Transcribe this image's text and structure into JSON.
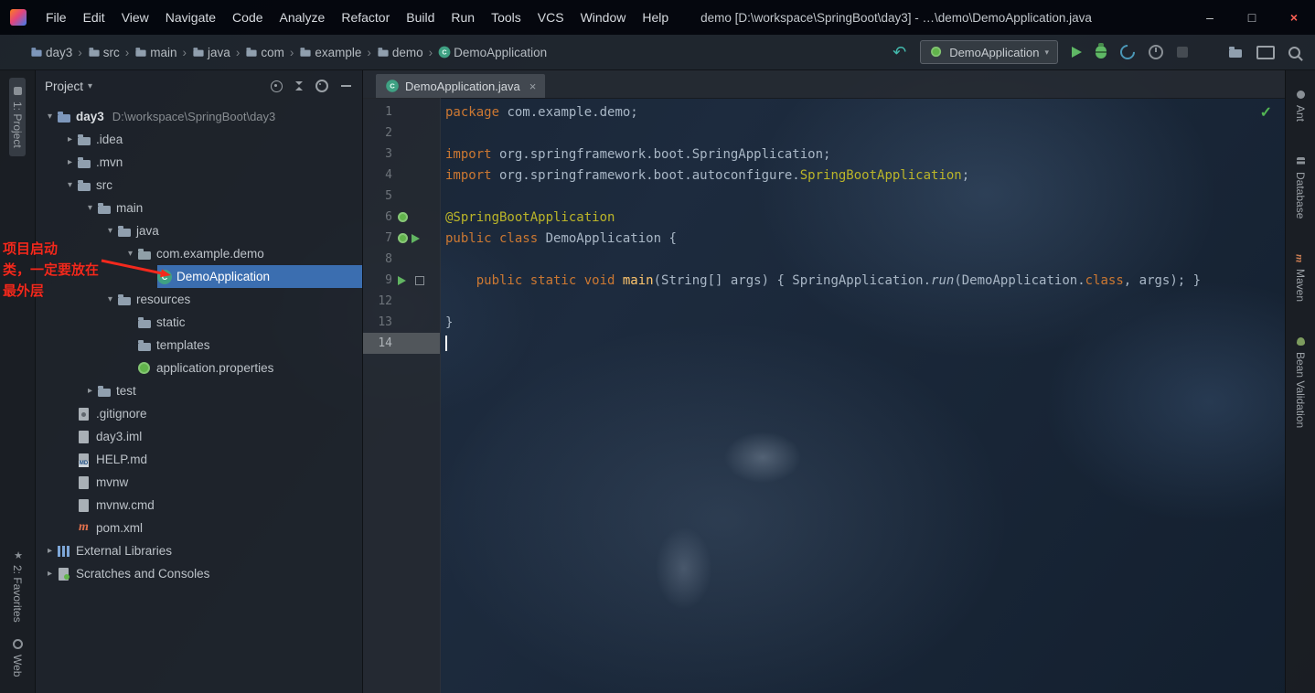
{
  "title_bar": {
    "title": "demo [D:\\workspace\\SpringBoot\\day3] - …\\demo\\DemoApplication.java",
    "menus": [
      "File",
      "Edit",
      "View",
      "Navigate",
      "Code",
      "Analyze",
      "Refactor",
      "Build",
      "Run",
      "Tools",
      "VCS",
      "Window",
      "Help"
    ]
  },
  "nav_bar": {
    "breadcrumbs": [
      {
        "label": "day3",
        "icon": "folder-blue"
      },
      {
        "label": "src",
        "icon": "folder"
      },
      {
        "label": "main",
        "icon": "folder"
      },
      {
        "label": "java",
        "icon": "folder"
      },
      {
        "label": "com",
        "icon": "folder"
      },
      {
        "label": "example",
        "icon": "folder"
      },
      {
        "label": "demo",
        "icon": "folder"
      },
      {
        "label": "DemoApplication",
        "icon": "class"
      }
    ],
    "run_config": "DemoApplication"
  },
  "left_stripe": {
    "top": [
      {
        "label": "1: Project",
        "icon": "project",
        "active": true
      }
    ],
    "bottom": [
      {
        "label": "2: Favorites",
        "icon": "star"
      },
      {
        "label": "Web",
        "icon": "web"
      }
    ]
  },
  "right_stripe": [
    {
      "label": "Ant",
      "icon": "ant"
    },
    {
      "label": "Database",
      "icon": "database"
    },
    {
      "label": "Maven",
      "icon": "maven"
    },
    {
      "label": "Bean Validation",
      "icon": "bean"
    }
  ],
  "project": {
    "header_title": "Project",
    "tree": [
      {
        "depth": 0,
        "chev": "open",
        "icon": "folder-blue",
        "label": "day3",
        "bold": true,
        "sub": "D:\\workspace\\SpringBoot\\day3"
      },
      {
        "depth": 1,
        "chev": "closed",
        "icon": "folder",
        "label": ".idea"
      },
      {
        "depth": 1,
        "chev": "closed",
        "icon": "folder",
        "label": ".mvn"
      },
      {
        "depth": 1,
        "chev": "open",
        "icon": "folder",
        "label": "src"
      },
      {
        "depth": 2,
        "chev": "open",
        "icon": "folder",
        "label": "main"
      },
      {
        "depth": 3,
        "chev": "open",
        "icon": "folder",
        "label": "java"
      },
      {
        "depth": 4,
        "chev": "open",
        "icon": "package",
        "label": "com.example.demo"
      },
      {
        "depth": 5,
        "chev": "none",
        "icon": "class",
        "label": "DemoApplication",
        "selected": true
      },
      {
        "depth": 3,
        "chev": "open",
        "icon": "folder",
        "label": "resources"
      },
      {
        "depth": 4,
        "chev": "none",
        "icon": "folder",
        "label": "static"
      },
      {
        "depth": 4,
        "chev": "none",
        "icon": "folder",
        "label": "templates"
      },
      {
        "depth": 4,
        "chev": "none",
        "icon": "spring",
        "label": "application.properties"
      },
      {
        "depth": 2,
        "chev": "closed",
        "icon": "folder",
        "label": "test"
      },
      {
        "depth": 1,
        "chev": "none",
        "icon": "file-gear",
        "label": ".gitignore"
      },
      {
        "depth": 1,
        "chev": "none",
        "icon": "file",
        "label": "day3.iml"
      },
      {
        "depth": 1,
        "chev": "none",
        "icon": "md",
        "label": "HELP.md"
      },
      {
        "depth": 1,
        "chev": "none",
        "icon": "file",
        "label": "mvnw"
      },
      {
        "depth": 1,
        "chev": "none",
        "icon": "file",
        "label": "mvnw.cmd"
      },
      {
        "depth": 1,
        "chev": "none",
        "icon": "maven",
        "label": "pom.xml"
      },
      {
        "depth": 0,
        "chev": "closed",
        "icon": "lib",
        "label": "External Libraries"
      },
      {
        "depth": 0,
        "chev": "closed",
        "icon": "scratch",
        "label": "Scratches and Consoles"
      }
    ]
  },
  "annotation": {
    "lines": [
      "项目启动",
      "类，一定要放在",
      "最外层"
    ]
  },
  "editor": {
    "tab": "DemoApplication.java",
    "lines": [
      {
        "n": "1",
        "tokens": [
          [
            "kw",
            "package"
          ],
          [
            "pl",
            " com.example.demo;"
          ]
        ]
      },
      {
        "n": "2",
        "tokens": []
      },
      {
        "n": "3",
        "tokens": [
          [
            "kw",
            "import"
          ],
          [
            "pl",
            " org.springframework.boot.SpringApplication;"
          ]
        ]
      },
      {
        "n": "4",
        "tokens": [
          [
            "kw",
            "import"
          ],
          [
            "pl",
            " org.springframework.boot.autoconfigure."
          ],
          [
            "ann",
            "SpringBootApplication"
          ],
          [
            "pl",
            ";"
          ]
        ]
      },
      {
        "n": "5",
        "tokens": []
      },
      {
        "n": "6",
        "tokens": [
          [
            "ann",
            "@SpringBootApplication"
          ]
        ],
        "gutter": [
          "spring"
        ]
      },
      {
        "n": "7",
        "tokens": [
          [
            "kw",
            "public class"
          ],
          [
            "pl",
            " DemoApplication {"
          ]
        ],
        "gutter": [
          "spring",
          "run"
        ]
      },
      {
        "n": "8",
        "tokens": []
      },
      {
        "n": "9",
        "tokens": [
          [
            "pl",
            "    "
          ],
          [
            "kw",
            "public static void "
          ],
          [
            "fn",
            "main"
          ],
          [
            "pl",
            "(String[] args) { SpringApplication."
          ],
          [
            "it",
            "run"
          ],
          [
            "pl",
            "(DemoApplication."
          ],
          [
            "kw",
            "class"
          ],
          [
            "pl",
            ", args); }"
          ]
        ],
        "gutter": [
          "run",
          "fold"
        ]
      },
      {
        "n": "12",
        "tokens": []
      },
      {
        "n": "13",
        "tokens": [
          [
            "pl",
            "}"
          ]
        ]
      },
      {
        "n": "14",
        "tokens": [],
        "current": true,
        "caret": true
      }
    ]
  }
}
